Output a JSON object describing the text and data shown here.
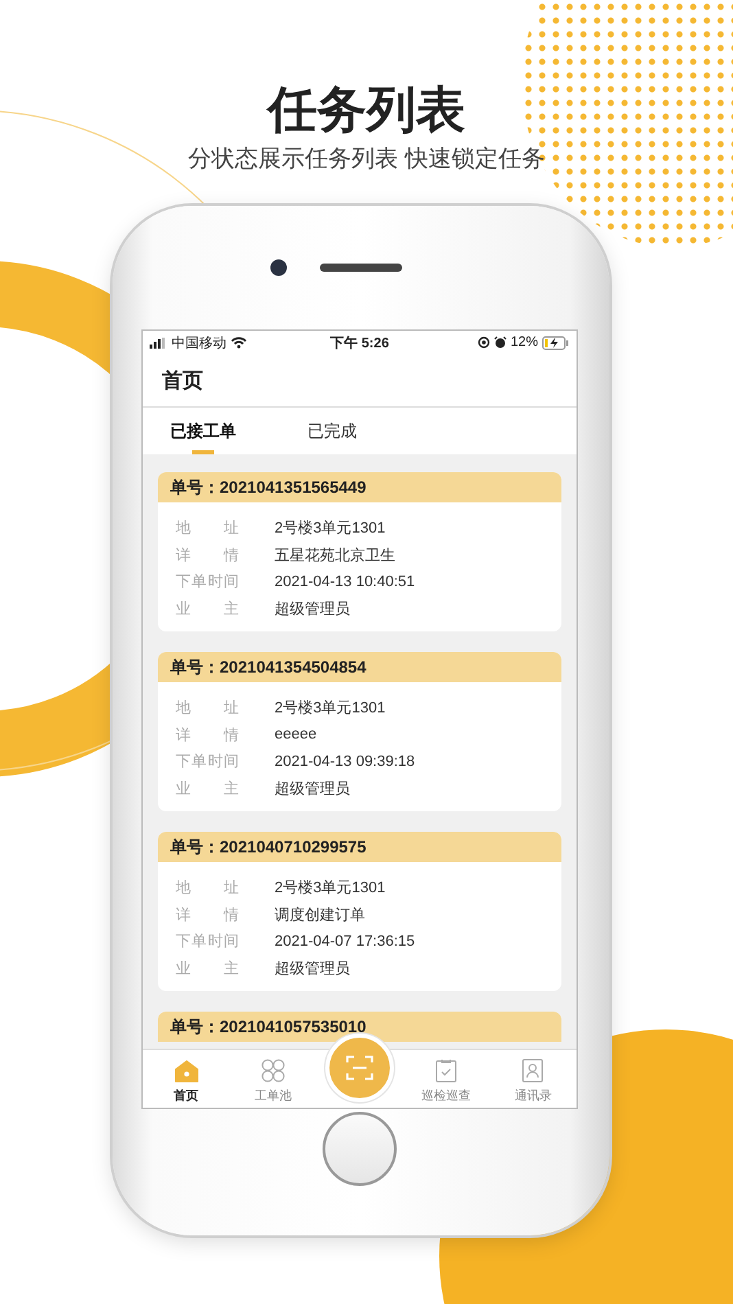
{
  "header": {
    "title": "任务列表",
    "subtitle": "分状态展示任务列表  快速锁定任务"
  },
  "status_bar": {
    "carrier": "中国移动",
    "time": "下午 5:26",
    "battery": "12%"
  },
  "nav": {
    "title": "首页"
  },
  "tabs": [
    {
      "label": "已接工单",
      "selected": true
    },
    {
      "label": "已完成",
      "selected": false
    }
  ],
  "orders": [
    {
      "title": "单号：2021041351565449",
      "fields": [
        {
          "label": "地址",
          "value": "2号楼3单元1301"
        },
        {
          "label": "详情",
          "value": "五星花苑北京卫生"
        },
        {
          "label": "下单时间",
          "value": "2021-04-13 10:40:51"
        },
        {
          "label": "业主",
          "value": "超级管理员"
        }
      ]
    },
    {
      "title": "单号：2021041354504854",
      "fields": [
        {
          "label": "地址",
          "value": "2号楼3单元1301"
        },
        {
          "label": "详情",
          "value": "eeeee"
        },
        {
          "label": "下单时间",
          "value": "2021-04-13 09:39:18"
        },
        {
          "label": "业主",
          "value": "超级管理员"
        }
      ]
    },
    {
      "title": "单号：2021040710299575",
      "fields": [
        {
          "label": "地址",
          "value": "2号楼3单元1301"
        },
        {
          "label": "详情",
          "value": "调度创建订单"
        },
        {
          "label": "下单时间",
          "value": "2021-04-07 17:36:15"
        },
        {
          "label": "业主",
          "value": "超级管理员"
        }
      ]
    },
    {
      "title": "单号：2021041057535010"
    }
  ],
  "tab_bar": [
    {
      "kind": "home",
      "label": "首页",
      "selected": true
    },
    {
      "kind": "pool",
      "label": "工单池",
      "selected": false
    },
    {
      "kind": "scan",
      "selected": false
    },
    {
      "kind": "patrol",
      "label": "巡检巡查",
      "selected": false
    },
    {
      "kind": "contacts",
      "label": "通讯录",
      "selected": false
    }
  ]
}
